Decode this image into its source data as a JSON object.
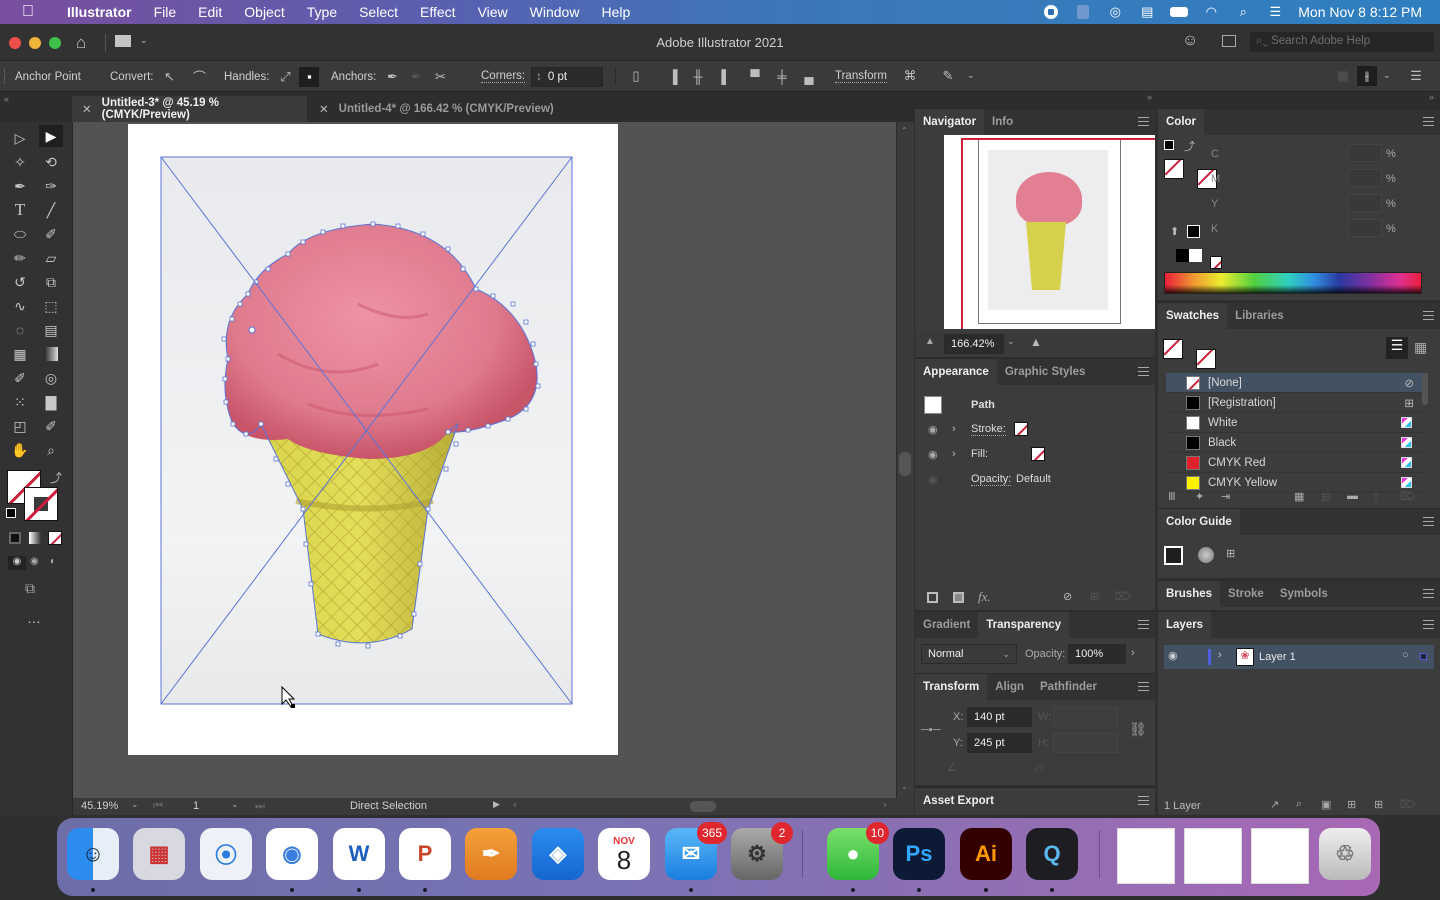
{
  "menubar": {
    "app_name": "Illustrator",
    "items": [
      "File",
      "Edit",
      "Object",
      "Type",
      "Select",
      "Effect",
      "View",
      "Window",
      "Help"
    ],
    "clock": "Mon Nov 8  8:12 PM"
  },
  "window": {
    "title": "Adobe Illustrator 2021",
    "search_placeholder": "Search Adobe Help"
  },
  "control_bar": {
    "mode_label": "Anchor Point",
    "convert_label": "Convert:",
    "handles_label": "Handles:",
    "anchors_label": "Anchors:",
    "corners_label": "Corners:",
    "corners_value": "0 pt",
    "transform_label": "Transform"
  },
  "doc_tabs": [
    {
      "label": "Untitled-3* @ 45.19 % (CMYK/Preview)",
      "active": true
    },
    {
      "label": "Untitled-4* @ 166.42 % (CMYK/Preview)",
      "active": false
    }
  ],
  "status_bar": {
    "zoom": "45.19%",
    "artboard": "1",
    "tool": "Direct Selection"
  },
  "navigator": {
    "tabs": [
      "Navigator",
      "Info"
    ],
    "zoom": "166.42%"
  },
  "appearance": {
    "tabs": [
      "Appearance",
      "Graphic Styles"
    ],
    "object": "Path",
    "stroke_label": "Stroke:",
    "fill_label": "Fill:",
    "opacity_label": "Opacity:",
    "opacity_value": "Default"
  },
  "transparency": {
    "tabs": [
      "Gradient",
      "Transparency"
    ],
    "blend_mode": "Normal",
    "opacity_label": "Opacity:",
    "opacity_value": "100%"
  },
  "transform": {
    "tabs": [
      "Transform",
      "Align",
      "Pathfinder"
    ],
    "x_label": "X:",
    "x_value": "140 pt",
    "y_label": "Y:",
    "y_value": "245 pt",
    "w_label": "W:",
    "h_label": "H:"
  },
  "asset_export": {
    "title": "Asset Export"
  },
  "color": {
    "title": "Color",
    "channels": [
      "C",
      "M",
      "Y",
      "K"
    ],
    "unit": "%"
  },
  "swatches": {
    "tabs": [
      "Swatches",
      "Libraries"
    ],
    "items": [
      {
        "name": "[None]",
        "color": "none",
        "selected": true
      },
      {
        "name": "[Registration]",
        "color": "#000000"
      },
      {
        "name": "White",
        "color": "#ffffff"
      },
      {
        "name": "Black",
        "color": "#000000"
      },
      {
        "name": "CMYK Red",
        "color": "#e0202a"
      },
      {
        "name": "CMYK Yellow",
        "color": "#fff200"
      }
    ]
  },
  "color_guide": {
    "title": "Color Guide"
  },
  "brushes": {
    "tabs": [
      "Brushes",
      "Stroke",
      "Symbols"
    ]
  },
  "layers": {
    "title": "Layers",
    "items": [
      {
        "name": "Layer 1"
      }
    ],
    "count": "1 Layer"
  },
  "dock": {
    "apps": [
      {
        "name": "Finder"
      },
      {
        "name": "Launchpad"
      },
      {
        "name": "Safari"
      },
      {
        "name": "Chrome"
      },
      {
        "name": "Word",
        "glyph": "W"
      },
      {
        "name": "PowerPoint",
        "glyph": "P"
      },
      {
        "name": "Pages"
      },
      {
        "name": "Keynote"
      },
      {
        "name": "Calendar",
        "month": "NOV",
        "day": "8"
      },
      {
        "name": "Mail",
        "badge": "365"
      },
      {
        "name": "System Preferences",
        "badge": "2"
      },
      {
        "name": "Messages",
        "badge": "10"
      },
      {
        "name": "Photoshop",
        "glyph": "Ps"
      },
      {
        "name": "Illustrator",
        "glyph": "Ai"
      },
      {
        "name": "QuickTime"
      },
      {
        "name": "Trash"
      }
    ]
  }
}
